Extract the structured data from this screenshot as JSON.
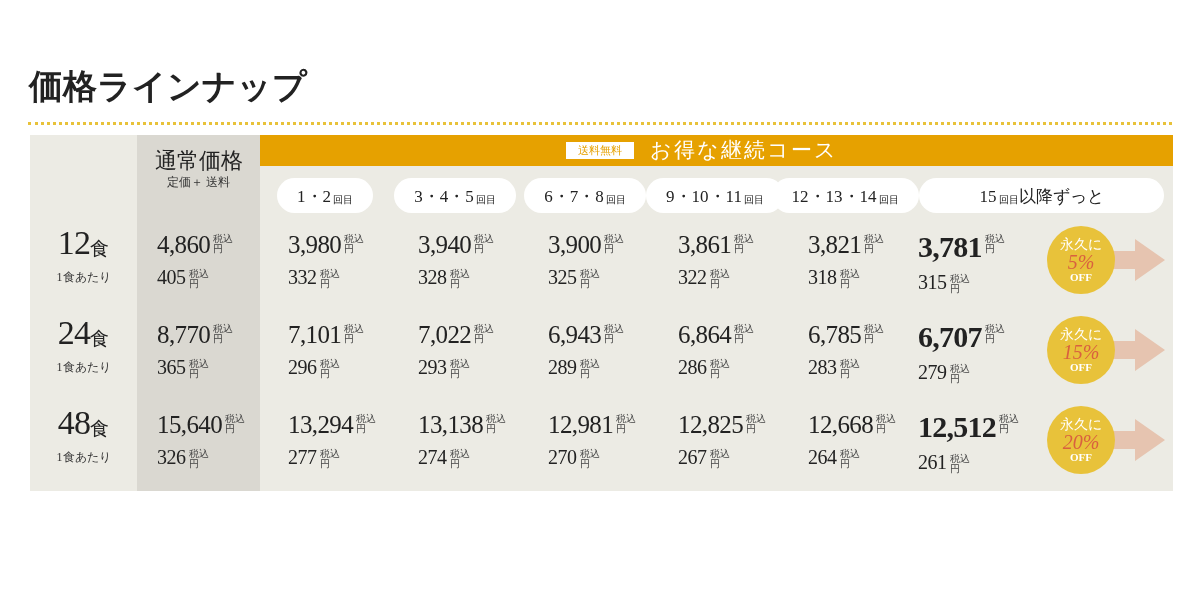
{
  "title": "価格ラインナップ",
  "regular_header": {
    "title": "通常価格",
    "subtitle": "定価＋ 送料"
  },
  "course_header": {
    "badge": "送料無料",
    "title": "お得な継続コース"
  },
  "periods": [
    {
      "number": "1・2",
      "suffix": "回目"
    },
    {
      "number": "3・4・5",
      "suffix": "回目"
    },
    {
      "number": "6・7・8",
      "suffix": "回目"
    },
    {
      "number": "9・10・11",
      "suffix": "回目"
    },
    {
      "number": "12・13・14",
      "suffix": "回目"
    },
    {
      "number": "15",
      "suffix": "回目",
      "extra": "以降ずっと"
    }
  ],
  "rows": [
    {
      "count": "12",
      "unit": "食",
      "per_label": "1食あたり",
      "regular": {
        "total": {
          "amount": "4,860",
          "tax": "税込",
          "yen": "円"
        },
        "each": {
          "amount": "405",
          "tax": "税込",
          "yen": "円"
        }
      },
      "prices": [
        {
          "total": {
            "amount": "3,980",
            "tax": "税込",
            "yen": "円"
          },
          "each": {
            "amount": "332",
            "tax": "税込",
            "yen": "円"
          }
        },
        {
          "total": {
            "amount": "3,940",
            "tax": "税込",
            "yen": "円"
          },
          "each": {
            "amount": "328",
            "tax": "税込",
            "yen": "円"
          }
        },
        {
          "total": {
            "amount": "3,900",
            "tax": "税込",
            "yen": "円"
          },
          "each": {
            "amount": "325",
            "tax": "税込",
            "yen": "円"
          }
        },
        {
          "total": {
            "amount": "3,861",
            "tax": "税込",
            "yen": "円"
          },
          "each": {
            "amount": "322",
            "tax": "税込",
            "yen": "円"
          }
        },
        {
          "total": {
            "amount": "3,821",
            "tax": "税込",
            "yen": "円"
          },
          "each": {
            "amount": "318",
            "tax": "税込",
            "yen": "円"
          }
        },
        {
          "total": {
            "amount": "3,781",
            "tax": "税込",
            "yen": "円"
          },
          "each": {
            "amount": "315",
            "tax": "税込",
            "yen": "円"
          }
        }
      ],
      "discount": {
        "label": "永久に",
        "percent": "5%",
        "off": "OFF"
      }
    },
    {
      "count": "24",
      "unit": "食",
      "per_label": "1食あたり",
      "regular": {
        "total": {
          "amount": "8,770",
          "tax": "税込",
          "yen": "円"
        },
        "each": {
          "amount": "365",
          "tax": "税込",
          "yen": "円"
        }
      },
      "prices": [
        {
          "total": {
            "amount": "7,101",
            "tax": "税込",
            "yen": "円"
          },
          "each": {
            "amount": "296",
            "tax": "税込",
            "yen": "円"
          }
        },
        {
          "total": {
            "amount": "7,022",
            "tax": "税込",
            "yen": "円"
          },
          "each": {
            "amount": "293",
            "tax": "税込",
            "yen": "円"
          }
        },
        {
          "total": {
            "amount": "6,943",
            "tax": "税込",
            "yen": "円"
          },
          "each": {
            "amount": "289",
            "tax": "税込",
            "yen": "円"
          }
        },
        {
          "total": {
            "amount": "6,864",
            "tax": "税込",
            "yen": "円"
          },
          "each": {
            "amount": "286",
            "tax": "税込",
            "yen": "円"
          }
        },
        {
          "total": {
            "amount": "6,785",
            "tax": "税込",
            "yen": "円"
          },
          "each": {
            "amount": "283",
            "tax": "税込",
            "yen": "円"
          }
        },
        {
          "total": {
            "amount": "6,707",
            "tax": "税込",
            "yen": "円"
          },
          "each": {
            "amount": "279",
            "tax": "税込",
            "yen": "円"
          }
        }
      ],
      "discount": {
        "label": "永久に",
        "percent": "15%",
        "off": "OFF"
      }
    },
    {
      "count": "48",
      "unit": "食",
      "per_label": "1食あたり",
      "regular": {
        "total": {
          "amount": "15,640",
          "tax": "税込",
          "yen": "円"
        },
        "each": {
          "amount": "326",
          "tax": "税込",
          "yen": "円"
        }
      },
      "prices": [
        {
          "total": {
            "amount": "13,294",
            "tax": "税込",
            "yen": "円"
          },
          "each": {
            "amount": "277",
            "tax": "税込",
            "yen": "円"
          }
        },
        {
          "total": {
            "amount": "13,138",
            "tax": "税込",
            "yen": "円"
          },
          "each": {
            "amount": "274",
            "tax": "税込",
            "yen": "円"
          }
        },
        {
          "total": {
            "amount": "12,981",
            "tax": "税込",
            "yen": "円"
          },
          "each": {
            "amount": "270",
            "tax": "税込",
            "yen": "円"
          }
        },
        {
          "total": {
            "amount": "12,825",
            "tax": "税込",
            "yen": "円"
          },
          "each": {
            "amount": "267",
            "tax": "税込",
            "yen": "円"
          }
        },
        {
          "total": {
            "amount": "12,668",
            "tax": "税込",
            "yen": "円"
          },
          "each": {
            "amount": "264",
            "tax": "税込",
            "yen": "円"
          }
        },
        {
          "total": {
            "amount": "12,512",
            "tax": "税込",
            "yen": "円"
          },
          "each": {
            "amount": "261",
            "tax": "税込",
            "yen": "円"
          }
        }
      ],
      "discount": {
        "label": "永久に",
        "percent": "20%",
        "off": "OFF"
      }
    }
  ]
}
